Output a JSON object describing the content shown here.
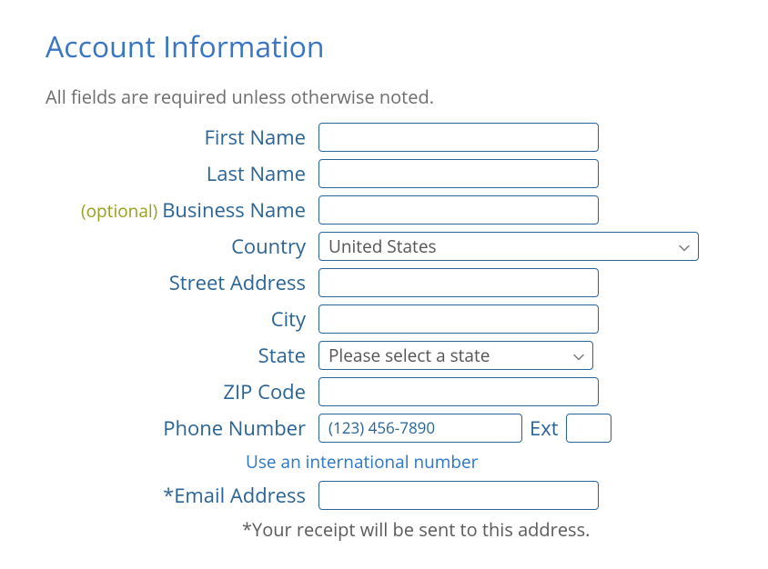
{
  "heading": "Account Information",
  "subheading": "All fields are required unless otherwise noted.",
  "optional_prefix": "(optional) ",
  "fields": {
    "first_name": {
      "label": "First Name",
      "value": ""
    },
    "last_name": {
      "label": "Last Name",
      "value": ""
    },
    "business_name": {
      "label": "Business Name",
      "value": ""
    },
    "country": {
      "label": "Country",
      "selected": "United States"
    },
    "street_address": {
      "label": "Street Address",
      "value": ""
    },
    "city": {
      "label": "City",
      "value": ""
    },
    "state": {
      "label": "State",
      "selected": "Please select a state"
    },
    "zip": {
      "label": "ZIP Code",
      "value": ""
    },
    "phone": {
      "label": "Phone Number",
      "placeholder": "(123) 456-7890",
      "value": "",
      "ext_label": "Ext",
      "ext_value": ""
    },
    "email": {
      "label": "Email Address",
      "value": ""
    }
  },
  "intl_link": "Use an international number",
  "email_note": "*Your receipt will be sent to this address."
}
